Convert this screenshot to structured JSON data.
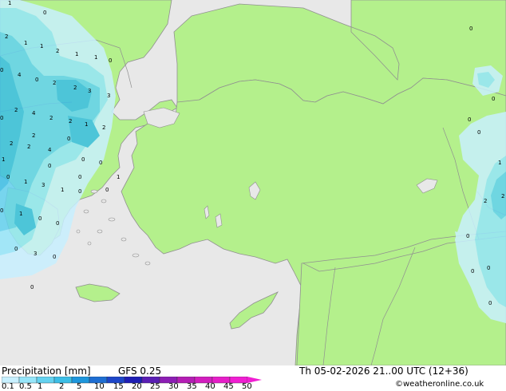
{
  "footer": {
    "title": "Precipitation [mm]",
    "model": "GFS 0.25",
    "valid_time": "Th 05-02-2026 21..00 UTC (12+36)",
    "credit": "©weatheronline.co.uk"
  },
  "legend": {
    "ticks": [
      "0.1",
      "0.5",
      "1",
      "2",
      "5",
      "10",
      "15",
      "20",
      "25",
      "30",
      "35",
      "40",
      "45",
      "50"
    ],
    "colors": [
      "#c8f0ff",
      "#96e6fa",
      "#64d2f0",
      "#3cbee6",
      "#1e96dc",
      "#1e6ed2",
      "#1e46c8",
      "#1e1eb4",
      "#5a1eb4",
      "#8c1eb4",
      "#b41eb4",
      "#d21ebe",
      "#e61ec8",
      "#f01ed2"
    ]
  },
  "map_colors": {
    "land": "#b4f08c",
    "sea": "#e8e8e8",
    "border": "#909090"
  },
  "values": [
    "1",
    "0",
    "2",
    "1",
    "1",
    "2",
    "1",
    "1",
    "0",
    "0",
    "4",
    "0",
    "2",
    "2",
    "3",
    "3",
    "2",
    "4",
    "2",
    "2",
    "1",
    "2",
    "2",
    "2",
    "4",
    "0",
    "0",
    "0",
    "1",
    "3",
    "1",
    "0",
    "0",
    "1",
    "0",
    "0",
    "0",
    "3",
    "0",
    "0",
    "0",
    "0",
    "0",
    "1",
    "2",
    "2",
    "0",
    "0",
    "0",
    "0",
    "1",
    "2",
    "0",
    "0",
    "1",
    "0",
    "0",
    "0",
    "0"
  ]
}
